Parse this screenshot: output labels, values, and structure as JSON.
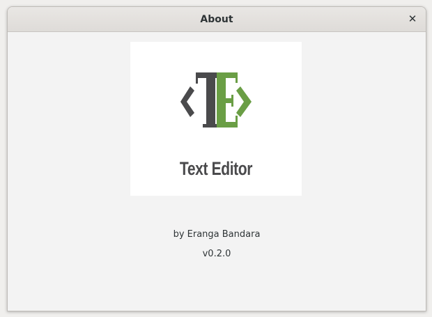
{
  "window": {
    "title": "About",
    "close_icon": "close-icon"
  },
  "logo": {
    "app_name": "Text Editor",
    "colors": {
      "dark": "#4a4a4c",
      "green": "#6a9e45"
    }
  },
  "about": {
    "author": "by Eranga Bandara",
    "version": "v0.2.0"
  }
}
